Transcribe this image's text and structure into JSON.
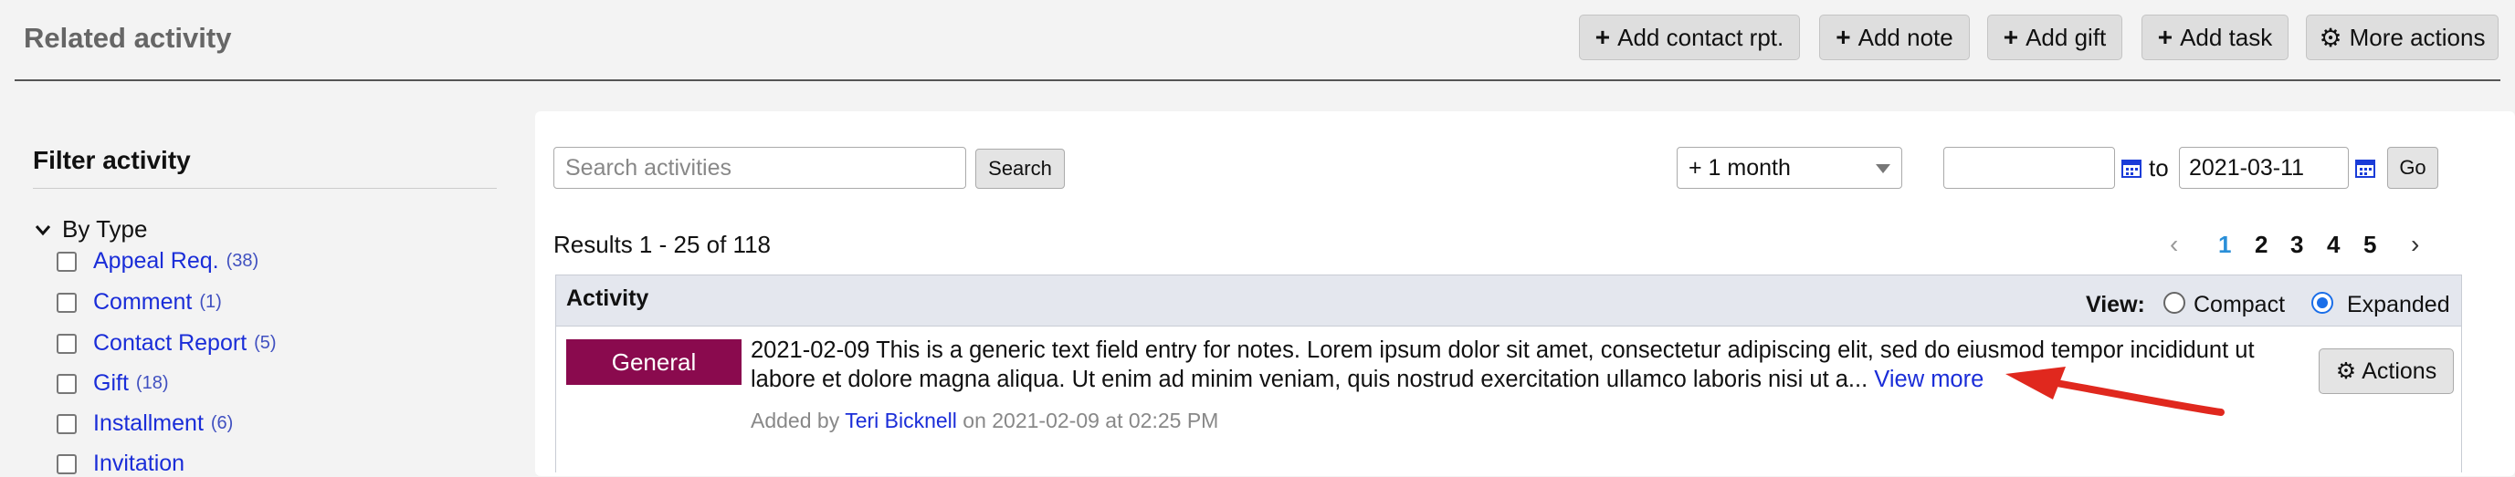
{
  "header": {
    "title": "Related activity",
    "buttons": [
      {
        "icon": "plus-icon",
        "glyph": "+",
        "label": "Add contact rpt."
      },
      {
        "icon": "plus-icon",
        "glyph": "+",
        "label": "Add note"
      },
      {
        "icon": "plus-icon",
        "glyph": "+",
        "label": "Add gift"
      },
      {
        "icon": "plus-icon",
        "glyph": "+",
        "label": "Add task"
      },
      {
        "icon": "gear-icon",
        "glyph": "⚙",
        "label": "More actions"
      }
    ]
  },
  "sidebar": {
    "title": "Filter activity",
    "group_label": "By Type",
    "items": [
      {
        "label": "Appeal Req.",
        "count": "(38)"
      },
      {
        "label": "Comment",
        "count": "(1)"
      },
      {
        "label": "Contact Report",
        "count": "(5)"
      },
      {
        "label": "Gift",
        "count": "(18)"
      },
      {
        "label": "Installment",
        "count": "(6)"
      },
      {
        "label": "Invitation",
        "count": ""
      }
    ]
  },
  "search": {
    "placeholder": "Search activities",
    "button_label": "Search"
  },
  "filters": {
    "period_selected": "+ 1 month",
    "date_from": "",
    "to_label": "to",
    "date_to": "2021-03-11",
    "go_label": "Go"
  },
  "results": {
    "summary": "Results 1 - 25 of 118"
  },
  "pagination": {
    "prev": "‹",
    "next": "›",
    "pages": [
      "1",
      "2",
      "3",
      "4",
      "5"
    ],
    "current": "1"
  },
  "table": {
    "column_activity": "Activity",
    "view_label": "View:",
    "view_options": [
      "Compact",
      "Expanded"
    ],
    "view_selected": "Expanded",
    "rows": [
      {
        "type": "General",
        "text": "2021-02-09 This is a generic text field entry for notes. Lorem ipsum dolor sit amet, consectetur adipiscing elit, sed do eiusmod tempor incididunt ut labore et dolore magna aliqua. Ut enim ad minim veniam, quis nostrud exercitation ullamco laboris nisi ut a...",
        "view_more": "View more",
        "added_prefix": "Added by",
        "author": "Teri Bicknell",
        "added_suffix": "on 2021-02-09 at 02:25 PM",
        "actions_label": "Actions"
      }
    ]
  },
  "colors": {
    "badge_general": "#8a0a4e",
    "link": "#1a2dd8",
    "annotation_arrow": "#e0281e",
    "calendar_icon": "#1a3cd8"
  }
}
